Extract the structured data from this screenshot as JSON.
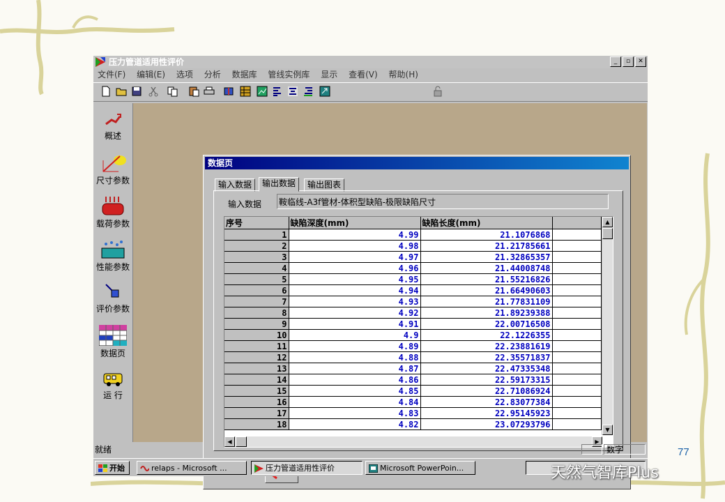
{
  "app": {
    "title": "压力管道适用性评价",
    "menus": [
      "文件(F)",
      "编辑(E)",
      "选项",
      "分析",
      "数据库",
      "管线实例库",
      "显示",
      "查看(V)",
      "帮助(H)"
    ]
  },
  "left_nav": [
    {
      "label": "概述",
      "icon": "overview-icon"
    },
    {
      "label": "尺寸参数",
      "icon": "size-params-icon"
    },
    {
      "label": "载荷参数",
      "icon": "load-params-icon"
    },
    {
      "label": "性能参数",
      "icon": "performance-params-icon"
    },
    {
      "label": "评价参数",
      "icon": "evaluation-params-icon"
    },
    {
      "label": "数据页",
      "icon": "data-page-icon"
    },
    {
      "label": "运  行",
      "icon": "run-icon"
    }
  ],
  "data_window": {
    "title": "数据页",
    "tabs": [
      "输入数据",
      "输出数据",
      "输出图表"
    ],
    "active_tab": "输出数据",
    "input_label": "输入数据",
    "input_value": "鞍临线-A3f管材-体积型缺陷-极限缺陷尺寸",
    "columns": [
      "序号",
      "缺陷深度(mm)",
      "缺陷长度(mm)",
      ""
    ],
    "rows": [
      [
        "1",
        "4.99",
        "21.1076868"
      ],
      [
        "2",
        "4.98",
        "21.21785661"
      ],
      [
        "3",
        "4.97",
        "21.32865357"
      ],
      [
        "4",
        "4.96",
        "21.44008748"
      ],
      [
        "5",
        "4.95",
        "21.55216826"
      ],
      [
        "6",
        "4.94",
        "21.66490603"
      ],
      [
        "7",
        "4.93",
        "21.77831109"
      ],
      [
        "8",
        "4.92",
        "21.89239388"
      ],
      [
        "9",
        "4.91",
        "22.00716508"
      ],
      [
        "10",
        "4.9",
        "22.1226355"
      ],
      [
        "11",
        "4.89",
        "22.23881619"
      ],
      [
        "12",
        "4.88",
        "22.35571837"
      ],
      [
        "13",
        "4.87",
        "22.47335348"
      ],
      [
        "14",
        "4.86",
        "22.59173315"
      ],
      [
        "15",
        "4.85",
        "22.71086924"
      ],
      [
        "16",
        "4.84",
        "22.83077384"
      ],
      [
        "17",
        "4.83",
        "22.95145923"
      ],
      [
        "18",
        "4.82",
        "23.07293796"
      ]
    ]
  },
  "status": {
    "ready": "就绪",
    "num": "数字"
  },
  "taskbar": {
    "start": "开始",
    "items": [
      "relaps - Microsoft ...",
      "压力管道适用性评价",
      "Microsoft PowerPoin..."
    ]
  },
  "slide": {
    "page_number": "77",
    "watermark": "天然气智库Plus"
  },
  "colors": {
    "title_bar_start": "#000080",
    "title_bar_end": "#1084d0",
    "value_text": "#0000c0",
    "page_number": "#1c62a8"
  }
}
